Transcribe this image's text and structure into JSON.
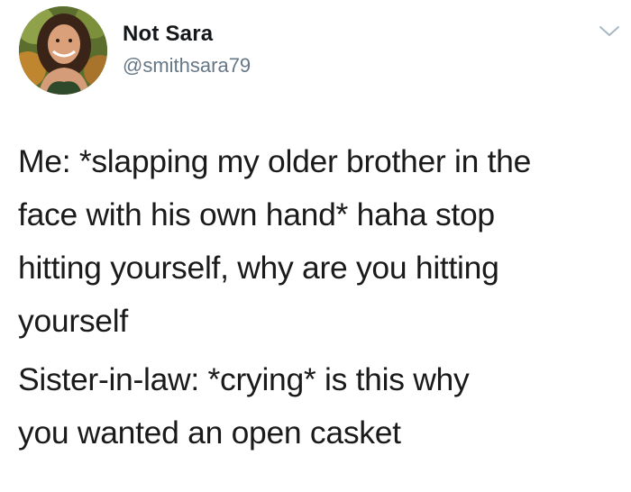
{
  "tweet": {
    "author": {
      "display_name": "Not Sara",
      "handle": "@smithsara79"
    },
    "menu_icon": "chevron-down-icon",
    "paragraphs": [
      {
        "lines": [
          "Me: *slapping my older brother in the",
          "face with his own hand* haha stop",
          "hitting yourself, why are you hitting",
          "yourself"
        ]
      },
      {
        "lines": [
          "Sister-in-law: *crying* is this why",
          "you wanted an open casket"
        ]
      }
    ]
  },
  "colors": {
    "text": "#1a1a1a",
    "handle": "#657786",
    "chevron": "#aab8c2"
  }
}
